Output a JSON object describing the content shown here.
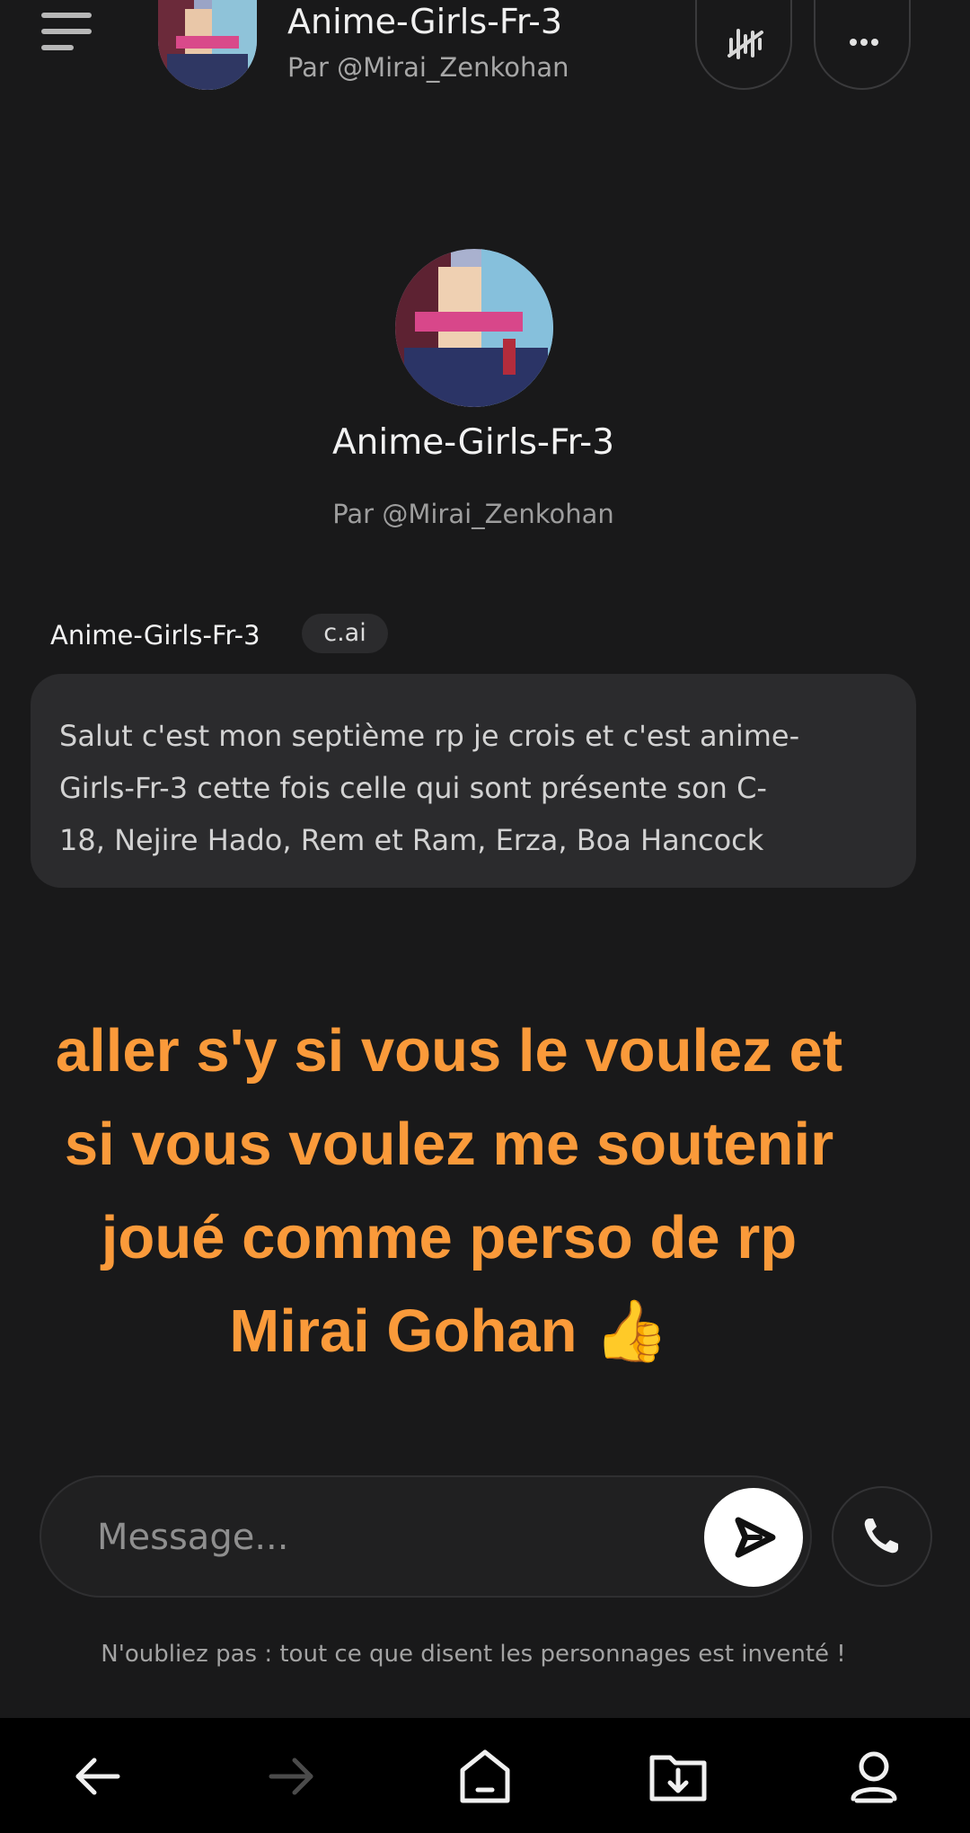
{
  "header": {
    "title": "Anime-Girls-Fr-3",
    "subtitle": "Par @Mirai_Zenkohan"
  },
  "profile": {
    "name": "Anime-Girls-Fr-3",
    "by": "Par @Mirai_Zenkohan"
  },
  "message": {
    "author": "Anime-Girls-Fr-3",
    "badge": "c.ai",
    "lines": [
      "Salut c'est mon septième rp je crois et c'est anime-",
      "Girls-Fr-3 cette fois celle qui sont présente son C-",
      "18, Nejire Hado, Rem et Ram, Erza, Boa Hancock"
    ]
  },
  "caption": {
    "lines": [
      "aller s'y si vous le voulez et",
      "si vous voulez me soutenir",
      "joué comme perso de rp",
      "Mirai Gohan 👍"
    ],
    "color": "#fa9a3a"
  },
  "composer": {
    "placeholder": "Message..."
  },
  "disclaimer": "N'oubliez pas : tout ce que disent les personnages est inventé !",
  "icons": {
    "menu": "menu-icon",
    "voice": "voice-muted-icon",
    "more": "more-horizontal-icon",
    "send": "send-icon",
    "call": "phone-icon",
    "back": "arrow-left-icon",
    "forward": "arrow-right-icon",
    "home": "home-icon",
    "downloads": "download-folder-icon",
    "account": "account-icon"
  }
}
